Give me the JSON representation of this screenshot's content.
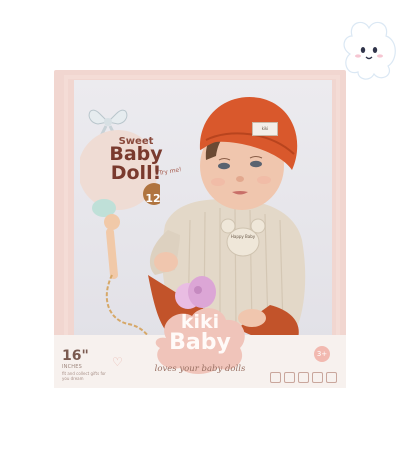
{
  "package": {
    "sticker": {
      "line1": "Sweet",
      "line2": "Baby",
      "line3": "Doll!",
      "try_me": "Try me!",
      "number": "12"
    },
    "brand": {
      "line1": "kiki",
      "line2": "Baby",
      "tagline": "loves your baby dolls"
    },
    "size": {
      "value": "16\"",
      "unit_label": "INCHES",
      "note": "fit and collect gifts for you dream"
    },
    "age_badge": "3+",
    "hat_tag": "kiki",
    "chest_patch": "Happy Baby"
  },
  "colors": {
    "box": "#f1d6d0",
    "hat": "#d9582c",
    "sweater": "#e3d8c8",
    "pacifier": "#e7b7dd",
    "brand_cloud": "#f0c4ba"
  },
  "icons": [
    "mascot-icon",
    "heart-icon",
    "bow-icon",
    "pacifier-icon",
    "feature-icons"
  ]
}
